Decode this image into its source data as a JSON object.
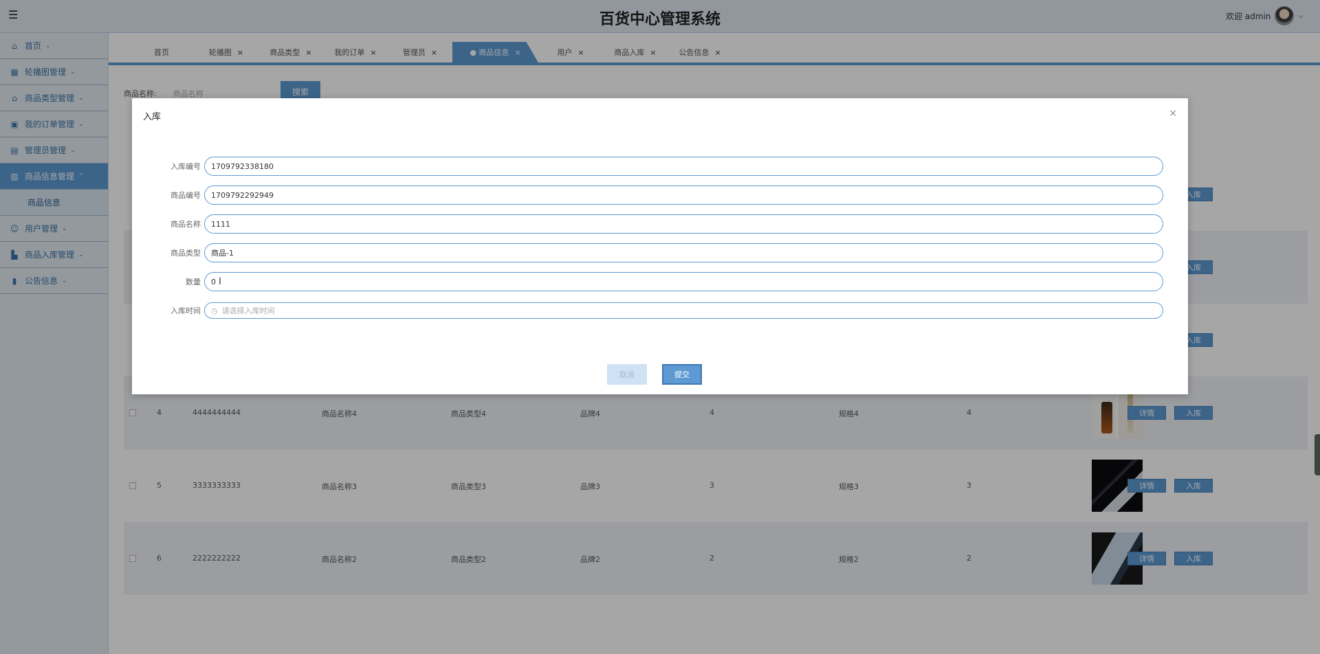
{
  "header": {
    "title": "百货中心管理系统",
    "welcome": "欢迎 admin"
  },
  "sidebar": {
    "items": [
      {
        "label": "首页",
        "icon": "home-icon"
      },
      {
        "label": "轮播图管理",
        "icon": "table-icon"
      },
      {
        "label": "商品类型管理",
        "icon": "store-icon"
      },
      {
        "label": "我的订单管理",
        "icon": "box-icon"
      },
      {
        "label": "管理员管理",
        "icon": "list-icon"
      },
      {
        "label": "商品信息管理",
        "icon": "bag-icon",
        "active": true
      },
      {
        "label": "用户管理",
        "icon": "user-icon"
      },
      {
        "label": "商品入库管理",
        "icon": "building-icon"
      },
      {
        "label": "公告信息",
        "icon": "book-icon"
      }
    ],
    "sub_item": "商品信息"
  },
  "tabs": [
    {
      "label": "首页",
      "closable": false
    },
    {
      "label": "轮播图",
      "closable": true
    },
    {
      "label": "商品类型",
      "closable": true
    },
    {
      "label": "我的订单",
      "closable": true
    },
    {
      "label": "管理员",
      "closable": true
    },
    {
      "label": "● 商品信息",
      "closable": true,
      "active": true
    },
    {
      "label": "用户",
      "closable": true
    },
    {
      "label": "商品入库",
      "closable": true
    },
    {
      "label": "公告信息",
      "closable": true
    }
  ],
  "search": {
    "label": "商品名称:",
    "placeholder": "商品名称",
    "button": "搜索"
  },
  "table": {
    "rows": [
      {
        "index": "4",
        "code": "4444444444",
        "name": "商品名称4",
        "type": "商品类型4",
        "brand": "品牌4",
        "qty": "4",
        "spec": "规格4",
        "stock": "4"
      },
      {
        "index": "5",
        "code": "3333333333",
        "name": "商品名称3",
        "type": "商品类型3",
        "brand": "品牌3",
        "qty": "3",
        "spec": "规格3",
        "stock": "3"
      },
      {
        "index": "6",
        "code": "2222222222",
        "name": "商品名称2",
        "type": "商品类型2",
        "brand": "品牌2",
        "qty": "2",
        "spec": "规格2",
        "stock": "2"
      }
    ],
    "detail_button": "详情",
    "stock_in_button": "入库"
  },
  "dialog": {
    "title": "入库",
    "close": "×",
    "fields": [
      {
        "label": "入库编号",
        "value": "1709792338180"
      },
      {
        "label": "商品编号",
        "value": "1709792292949"
      },
      {
        "label": "商品名称",
        "value": "1111"
      },
      {
        "label": "商品类型",
        "value": "商品-1"
      },
      {
        "label": "数量",
        "value": "0"
      },
      {
        "label": "入库时间",
        "value": "",
        "placeholder": "请选择入库时间"
      }
    ],
    "cancel": "取消",
    "submit": "提交"
  }
}
